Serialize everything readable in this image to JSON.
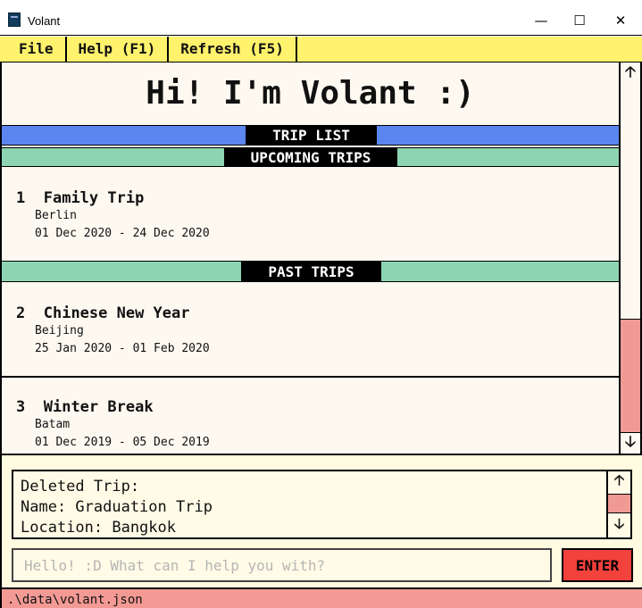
{
  "window": {
    "title": "Volant",
    "icon": "volant-app-icon",
    "controls": {
      "minimize": "—",
      "maximize": "☐",
      "close": "✕"
    }
  },
  "menu": {
    "items": [
      "File",
      "Help (F1)",
      "Refresh (F5)"
    ]
  },
  "main": {
    "greeting": "Hi! I'm Volant :)",
    "sections": {
      "trip_list": "TRIP LIST",
      "upcoming": "UPCOMING TRIPS",
      "past": "PAST TRIPS"
    },
    "trips": [
      {
        "index": "1",
        "name": "Family Trip",
        "location": "Berlin",
        "dates": "01 Dec 2020 - 24 Dec 2020"
      },
      {
        "index": "2",
        "name": "Chinese New Year",
        "location": "Beijing",
        "dates": "25 Jan 2020 - 01 Feb 2020"
      },
      {
        "index": "3",
        "name": "Winter Break",
        "location": "Batam",
        "dates": "01 Dec 2019 - 05 Dec 2019"
      }
    ],
    "scrollbar": {
      "up": "🡡",
      "down": "🡣"
    }
  },
  "result": {
    "lines": [
      "Deleted Trip:",
      "Name: Graduation Trip",
      "Location: Bangkok"
    ],
    "scrollbar": {
      "up": "🡡",
      "down": "🡣"
    }
  },
  "command": {
    "value": "",
    "placeholder": "Hello! :D What can I help you with?",
    "enter_label": "ENTER"
  },
  "status": {
    "path": ".\\data\\volant.json"
  },
  "colors": {
    "menu_bg": "#fff26c",
    "trip_list_bar": "#5b86f0",
    "section_bar": "#8dd4b2",
    "scroll_thumb": "#f09a94",
    "enter_button": "#f3413c",
    "status_bg": "#f39a95"
  }
}
